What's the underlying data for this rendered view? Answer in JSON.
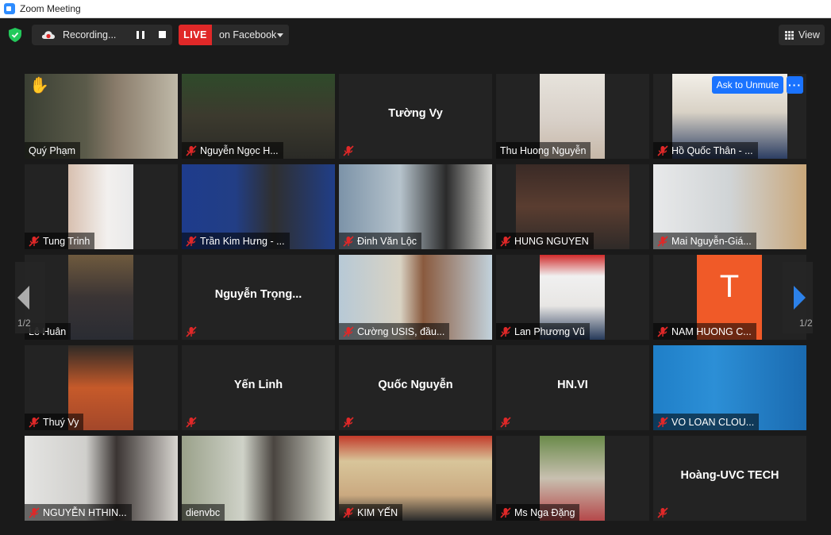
{
  "window": {
    "title": "Zoom Meeting"
  },
  "topbar": {
    "recording_label": "Recording...",
    "live_label": "LIVE",
    "live_destination": "on Facebook",
    "view_label": "View"
  },
  "overlay": {
    "ask_unmute_label": "Ask to Unmute",
    "more_label": "···"
  },
  "pagination": {
    "left_page": "1/2",
    "right_page": "1/2"
  },
  "colors": {
    "accent": "#1a73ff",
    "live": "#e02828",
    "active_speaker": "#c8f000",
    "mic_muted": "#e02828"
  },
  "participants": [
    {
      "name": "Quý Phạm",
      "muted": false,
      "video": true,
      "raised_hand": true
    },
    {
      "name": "Nguyễn Ngọc H...",
      "muted": true,
      "video": true
    },
    {
      "name": "Tường Vy",
      "muted": true,
      "video": false
    },
    {
      "name": "Thu Huong Nguyễn",
      "muted": false,
      "video": true
    },
    {
      "name": "Hồ Quốc Thân - ...",
      "muted": true,
      "video": true
    },
    {
      "name": "Tung Trinh",
      "muted": true,
      "video": true
    },
    {
      "name": "Trần Kim Hưng - ...",
      "muted": true,
      "video": true
    },
    {
      "name": "Đinh Văn Lộc",
      "muted": true,
      "video": true
    },
    {
      "name": "HUNG NGUYEN",
      "muted": true,
      "video": true
    },
    {
      "name": "Mai Nguyễn-Giá...",
      "muted": true,
      "video": true
    },
    {
      "name": "Lê Huân",
      "muted": false,
      "video": true
    },
    {
      "name": "Nguyễn  Trọng...",
      "muted": true,
      "video": false
    },
    {
      "name": "Cường USIS, đầu...",
      "muted": true,
      "video": true
    },
    {
      "name": "Lan Phương Vũ",
      "muted": true,
      "video": true
    },
    {
      "name": "NAM HUONG C...",
      "muted": true,
      "video": true,
      "avatar_letter": "T"
    },
    {
      "name": "Thuý Vy",
      "muted": true,
      "video": true
    },
    {
      "name": "Yến Linh",
      "muted": true,
      "video": false
    },
    {
      "name": "Quốc Nguyễn",
      "muted": true,
      "video": false
    },
    {
      "name": "HN.VI",
      "muted": true,
      "video": false
    },
    {
      "name": "VO LOAN CLOU...",
      "muted": true,
      "video": true
    },
    {
      "name": "NGUYỄN HTHIN...",
      "muted": true,
      "video": true
    },
    {
      "name": "dienvbc",
      "muted": false,
      "video": true,
      "active_speaker": true
    },
    {
      "name": "KIM YẾN",
      "muted": true,
      "video": true
    },
    {
      "name": "Ms Nga Đặng",
      "muted": true,
      "video": true
    },
    {
      "name": "Hoàng-UVC TECH",
      "muted": true,
      "video": false
    }
  ]
}
